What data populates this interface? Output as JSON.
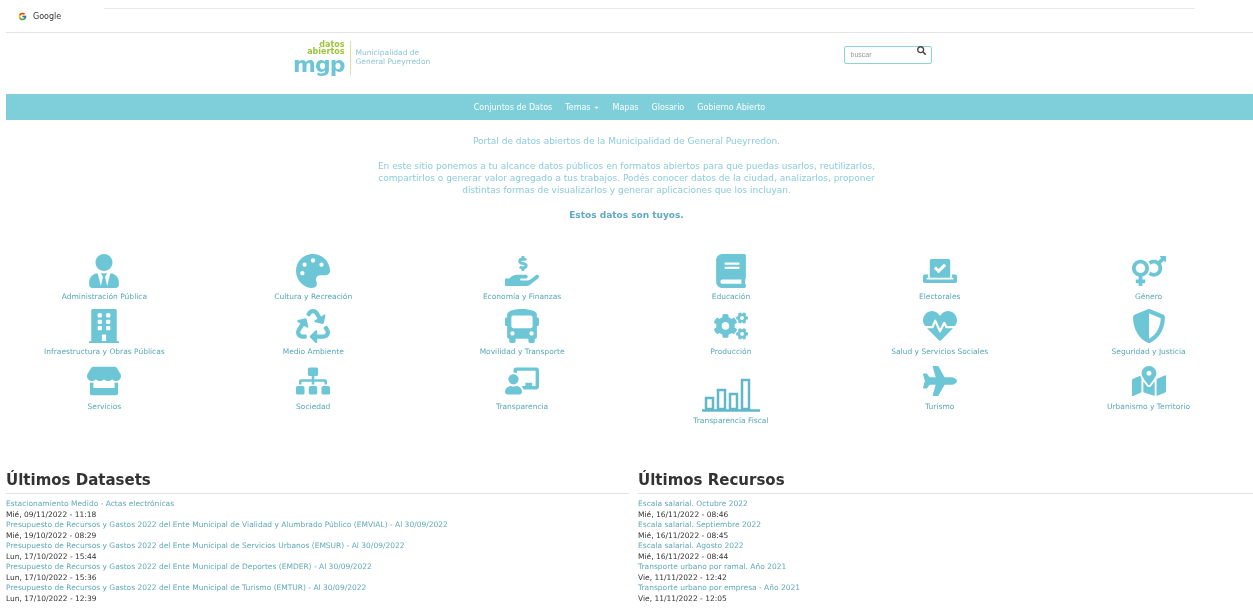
{
  "top_bar": {
    "google_label": "Google"
  },
  "logo": {
    "line_1": "datos",
    "line_2": "abiertos",
    "mark": "mgp",
    "subtitle": "Municipalidad de General Pueyrredon"
  },
  "search": {
    "placeholder": "buscar"
  },
  "nav": {
    "items": [
      {
        "label": "Conjuntos de Datos",
        "dropdown": false
      },
      {
        "label": "Temas",
        "dropdown": true
      },
      {
        "label": "Mapas",
        "dropdown": false
      },
      {
        "label": "Glosario",
        "dropdown": false
      },
      {
        "label": "Gobierno Abierto",
        "dropdown": false
      }
    ]
  },
  "intro": {
    "title": "Portal de datos abiertos de la Municipalidad de General Pueyrredon.",
    "body": "En este sitio ponemos a tu alcance datos públicos en formatos abiertos para que puedas usarlos, reutilizarlos, compartirlos o generar valor agregado a tus trabajos. Podés conocer datos de la ciudad, analizarlos, proponer distintas formas de visualizarlos y generar aplicaciones que los incluyan.",
    "tagline": "Estos datos son tuyos."
  },
  "categories": [
    {
      "label": "Administración Pública"
    },
    {
      "label": "Cultura y Recreación"
    },
    {
      "label": "Economía y Finanzas"
    },
    {
      "label": "Educación"
    },
    {
      "label": "Electorales"
    },
    {
      "label": "Género"
    },
    {
      "label": "Infraestructura y Obras Públicas"
    },
    {
      "label": "Medio Ambiente"
    },
    {
      "label": "Movilidad y Transporte"
    },
    {
      "label": "Producción"
    },
    {
      "label": "Salud y Servicios Sociales"
    },
    {
      "label": "Seguridad y Justicia"
    },
    {
      "label": "Servicios"
    },
    {
      "label": "Sociedad"
    },
    {
      "label": "Transparencia"
    },
    {
      "label": "Transparencia Fiscal"
    },
    {
      "label": "Turismo"
    },
    {
      "label": "Urbanismo y Territorio"
    }
  ],
  "latest_datasets": {
    "title": "Últimos Datasets",
    "items": [
      {
        "title": "Estacionamiento Medido - Actas electrónicas",
        "date": "Mié, 09/11/2022 - 11:18"
      },
      {
        "title": "Presupuesto de Recursos y Gastos 2022 del Ente Municipal de Vialidad y Alumbrado Público (EMVIAL) - Al 30/09/2022",
        "date": "Mié, 19/10/2022 - 08:29"
      },
      {
        "title": "Presupuesto de Recursos y Gastos 2022 del Ente Municipal de Servicios Urbanos (EMSUR) - Al 30/09/2022",
        "date": "Lun, 17/10/2022 - 15:44"
      },
      {
        "title": "Presupuesto de Recursos y Gastos 2022 del Ente Municipal de Deportes (EMDER) - Al 30/09/2022",
        "date": "Lun, 17/10/2022 - 15:36"
      },
      {
        "title": "Presupuesto de Recursos y Gastos 2022 del Ente Municipal de Turismo (EMTUR) - Al 30/09/2022",
        "date": "Lun, 17/10/2022 - 12:39"
      }
    ]
  },
  "latest_resources": {
    "title": "Últimos Recursos",
    "items": [
      {
        "title": "Escala salarial. Octubre 2022",
        "date": "Mié, 16/11/2022 - 08:46"
      },
      {
        "title": "Escala salarial. Septiembre 2022",
        "date": "Mié, 16/11/2022 - 08:45"
      },
      {
        "title": "Escala salarial. Agosto 2022",
        "date": "Mié, 16/11/2022 - 08:44"
      },
      {
        "title": "Transporte urbano por ramal. Año 2021",
        "date": "Vie, 11/11/2022 - 12:42"
      },
      {
        "title": "Transporte urbano por empresa - Año 2021",
        "date": "Vie, 11/11/2022 - 12:05"
      }
    ]
  }
}
